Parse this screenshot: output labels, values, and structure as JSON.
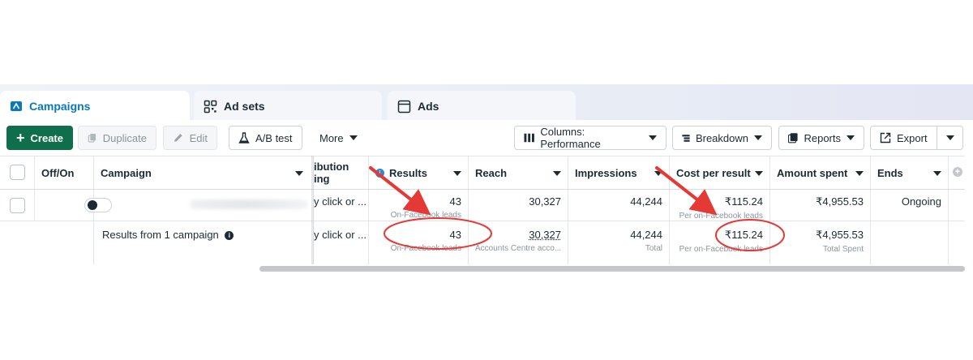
{
  "tabs": [
    {
      "label": "Campaigns",
      "icon": "folder-icon"
    },
    {
      "label": "Ad sets",
      "icon": "grid-icon"
    },
    {
      "label": "Ads",
      "icon": "window-icon"
    }
  ],
  "toolbar": {
    "create": "Create",
    "duplicate": "Duplicate",
    "edit": "Edit",
    "ab_test": "A/B test",
    "more": "More",
    "columns": "Columns: Performance",
    "breakdown": "Breakdown",
    "reports": "Reports",
    "export": "Export"
  },
  "table": {
    "headers": {
      "offon": "Off/On",
      "campaign": "Campaign",
      "attribution": "ibution\ning",
      "results": "Results",
      "reach": "Reach",
      "impressions": "Impressions",
      "cost_per_result": "Cost per result",
      "amount_spent": "Amount spent",
      "ends": "Ends"
    },
    "row": {
      "attribution": "y click or ...",
      "results": "43",
      "results_sub": "On-Facebook leads",
      "reach": "30,327",
      "impressions": "44,244",
      "cost_per_result": "₹115.24",
      "cost_sub": "Per on-Facebook leads",
      "amount_spent": "₹4,955.53",
      "ends": "Ongoing"
    },
    "summary": {
      "label": "Results from 1 campaign",
      "attribution": "y click or ...",
      "results": "43",
      "results_sub": "On-Facebook leads",
      "reach": "30,327",
      "reach_sub": "Accounts Centre acco...",
      "impressions": "44,244",
      "impressions_sub": "Total",
      "cost_per_result": "₹115.24",
      "cost_sub": "Per on-Facebook leads",
      "amount_spent": "₹4,955.53",
      "amount_sub": "Total Spent"
    }
  },
  "colors": {
    "accent_blue": "#0a78be",
    "create_green": "#0f6e4b",
    "annotation_red": "#e53935"
  }
}
